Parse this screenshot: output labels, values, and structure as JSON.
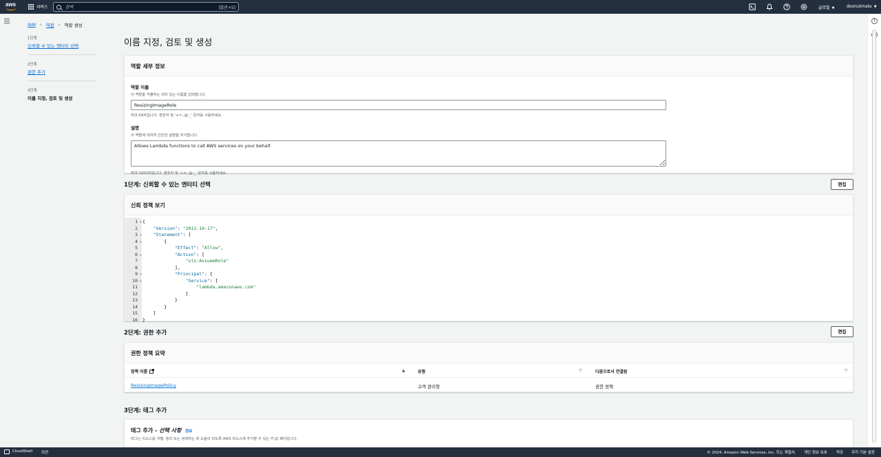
{
  "topnav": {
    "logo_text": "aws",
    "services_label": "서비스",
    "search_placeholder": "검색",
    "search_shortcut": "[옵션+S]",
    "icons": [
      "cloudshell-icon",
      "bell-icon",
      "help-icon",
      "settings-icon"
    ],
    "region_label": "글로벌",
    "account_label": "doonutmate"
  },
  "breadcrumb": {
    "items": [
      "IAM",
      "역할",
      "역할 생성"
    ]
  },
  "steps": [
    {
      "num": "1단계",
      "label": "신뢰할 수 있는 엔터티 선택"
    },
    {
      "num": "2단계",
      "label": "권한 추가"
    },
    {
      "num": "3단계",
      "label": "이름 지정, 검토 및 생성"
    }
  ],
  "page_title": "이름 지정, 검토 및 생성",
  "role_details": {
    "header": "역할 세부 정보",
    "name_label": "역할 이름",
    "name_desc": "이 역할을 식별하는 의미 있는 이름을 입력합니다.",
    "name_value": "ResizingImageRole",
    "name_hint": "최대 64자입니다. 영숫자 및 '+=,.@-_' 문자를 사용하세요.",
    "desc_label": "설명",
    "desc_desc": "이 역할에 대하여 간단한 설명을 추가합니다.",
    "desc_value": "Allows Lambda functions to call AWS services on your behalf.",
    "desc_hint": "최대 1000자입니다. 영숫자 및 '+=,.@-_' 문자를 사용하세요."
  },
  "step1": {
    "title": "1단계: 신뢰할 수 있는 엔터티 선택",
    "edit_label": "편집",
    "card_header": "신뢰 정책 보기",
    "code_lines": [
      "{",
      "    \"Version\": \"2012-10-17\",",
      "    \"Statement\": [",
      "        {",
      "            \"Effect\": \"Allow\",",
      "            \"Action\": [",
      "                \"sts:AssumeRole\"",
      "            ],",
      "            \"Principal\": {",
      "                \"Service\": [",
      "                    \"lambda.amazonaws.com\"",
      "                ]",
      "            }",
      "        }",
      "    ]",
      "}"
    ],
    "fold_lines": [
      1,
      3,
      4,
      6,
      9,
      10
    ]
  },
  "step2": {
    "title": "2단계: 권한 추가",
    "edit_label": "편집",
    "card_header": "권한 정책 요약",
    "columns": [
      "정책 이름",
      "유형",
      "다음으로서 연결됨"
    ],
    "rows": [
      {
        "policy": "ResizingImagePolicy",
        "type": "고객 관리형",
        "attached": "권한 정책"
      }
    ]
  },
  "step3": {
    "title": "3단계: 태그 추가",
    "card_header_main": "태그 추가 - ",
    "card_header_optional": "선택 사항",
    "info_label": "정보",
    "card_desc": "태그는 리소스를 식별, 정리 또는 검색하는 데 도움이 되도록 AWS 리소스에 추가할 수 있는 키-값 페어입니다."
  },
  "footer": {
    "cloudshell_label": "CloudShell",
    "feedback_label": "의견",
    "copyright": "© 2024, Amazon Web Services, Inc. 또는 계열사.",
    "privacy": "개인 정보 보호",
    "terms": "약관",
    "cookies": "쿠키 기본 설정"
  }
}
